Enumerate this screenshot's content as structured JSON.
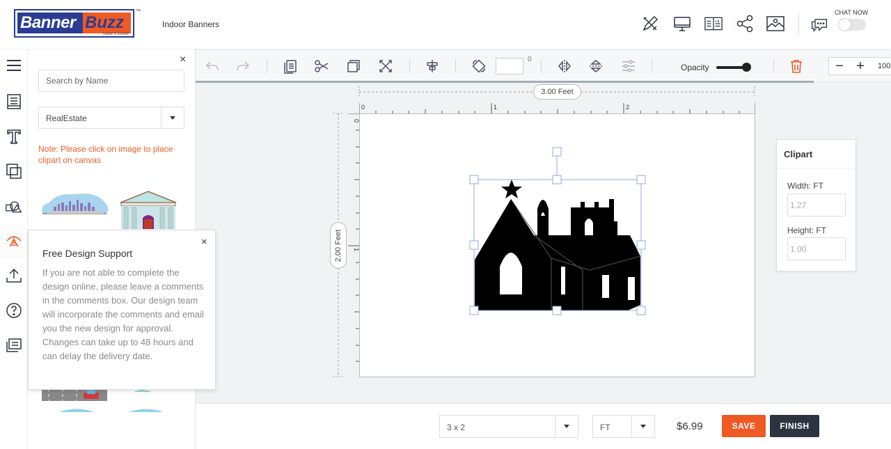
{
  "header": {
    "logo_part1": "Banner",
    "logo_part2": "Buzz",
    "logo_tagline": "make it visible",
    "trademark": "™",
    "title": "Indoor Banners",
    "chat_label": "CHAT NOW",
    "icons": [
      "pencil-ruler-icon",
      "monitor-icon",
      "book-icon",
      "share-icon",
      "image-icon",
      "chat-icon"
    ]
  },
  "rail": {
    "icons": [
      "menu-icon",
      "templates-icon",
      "text-icon",
      "layers-icon",
      "shapes-icon",
      "clipart-icon",
      "upload-icon",
      "help-icon",
      "comments-icon"
    ]
  },
  "panel": {
    "close": "×",
    "search_placeholder": "Search by Name",
    "category_selected": "RealEstate",
    "note": "Note: Please click on image to place clipart on canvas"
  },
  "popup": {
    "title": "Free Design Support",
    "close": "×",
    "text": "If you are not able to complete the design online, please leave a comments in the comments box. Our design team will incorporate the comments and email you the new design for approval. Changes can take up to 48 hours and can delay the delivery date."
  },
  "toolbar": {
    "degree_symbol": "0",
    "opacity_label": "Opacity",
    "opacity_value": 0.85,
    "zoom_minus": "−",
    "zoom_plus": "+",
    "zoom_value": "100"
  },
  "canvas": {
    "width_label": "3.00 Feet",
    "height_label": "2.00 Feet",
    "ruler_h_labels": [
      "0",
      "1",
      "2"
    ],
    "ruler_v_labels": [
      "0",
      "1"
    ]
  },
  "clipart_props": {
    "title": "Clipart",
    "width_label": "Width: FT",
    "width_value": "1.27",
    "height_label": "Height: FT",
    "height_value": "1.00"
  },
  "footer": {
    "size_value": "3 x 2",
    "unit_value": "FT",
    "price": "$6.99",
    "save_label": "SAVE",
    "finish_label": "FINISH"
  },
  "colors": {
    "brand_blue": "#2b3d93",
    "brand_orange": "#ef5a24",
    "finish_dark": "#2c3442",
    "selection_blue": "#8fa8e0"
  }
}
